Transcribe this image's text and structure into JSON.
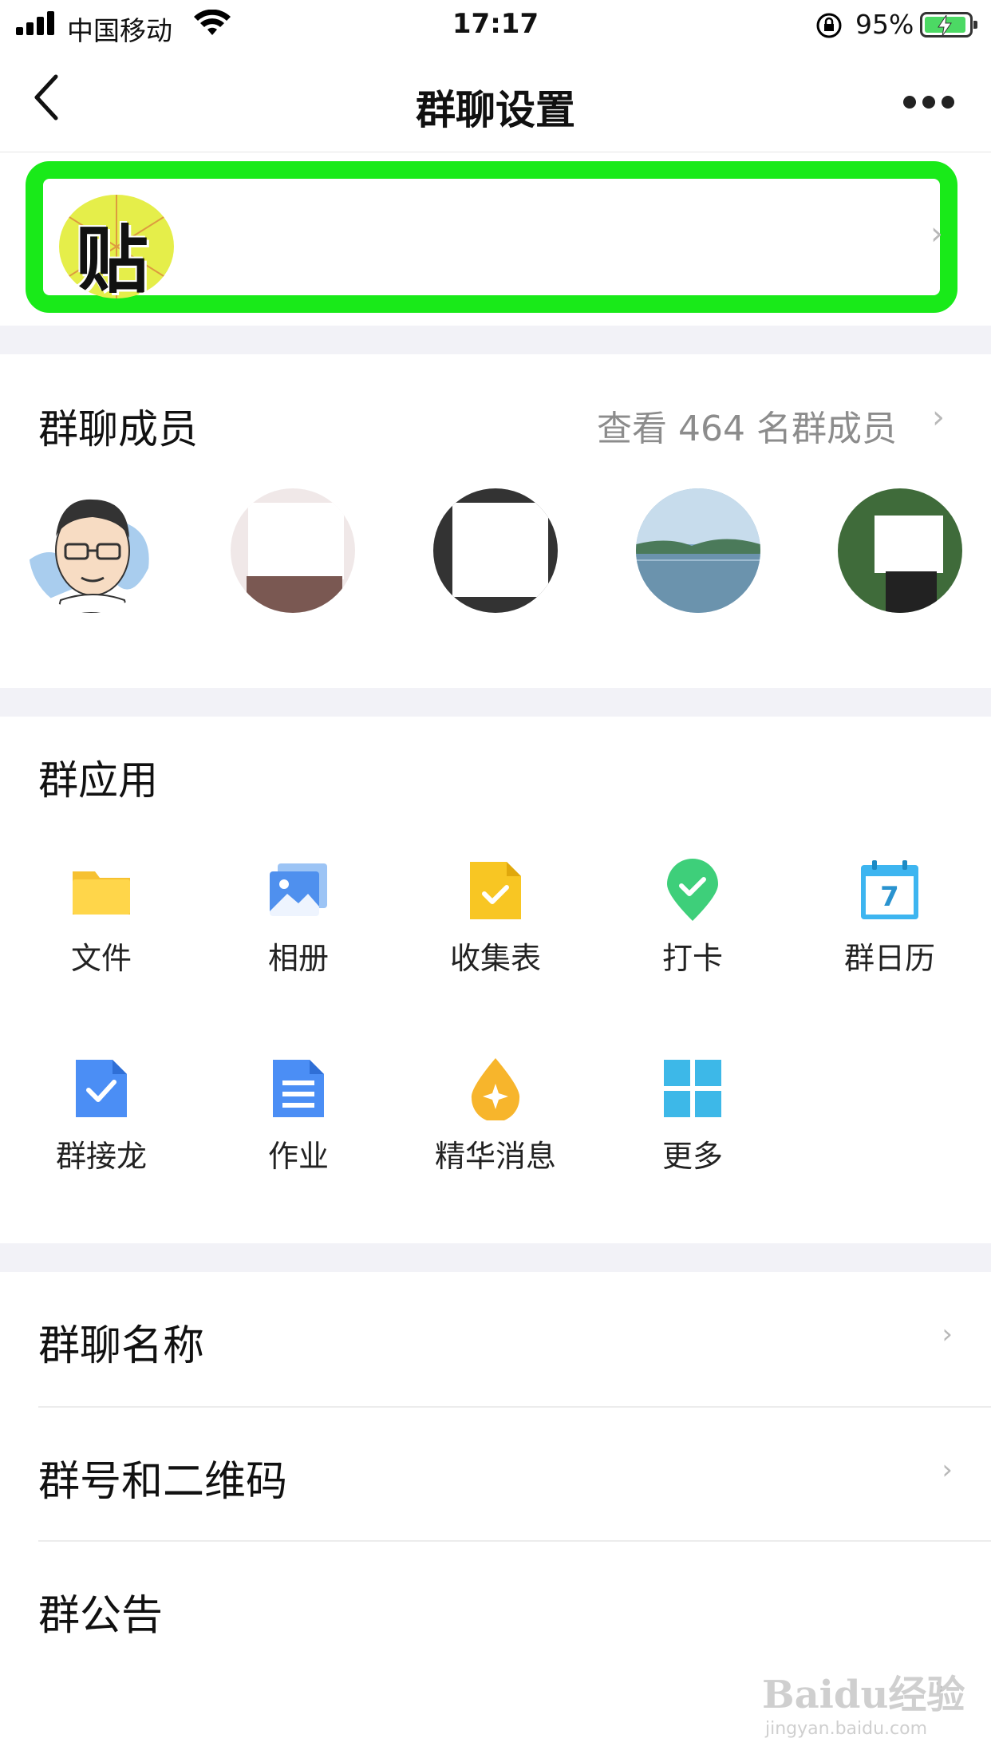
{
  "status_bar": {
    "carrier": "中国移动",
    "time": "17:17",
    "battery": "95%"
  },
  "nav": {
    "title": "群聊设置"
  },
  "members": {
    "title": "群聊成员",
    "view_all": "查看 464 名群成员"
  },
  "apps": {
    "title": "群应用",
    "items": [
      {
        "label": "文件",
        "icon": "folder-icon"
      },
      {
        "label": "相册",
        "icon": "album-icon"
      },
      {
        "label": "收集表",
        "icon": "form-icon"
      },
      {
        "label": "打卡",
        "icon": "checkin-icon"
      },
      {
        "label": "群日历",
        "icon": "calendar-icon"
      },
      {
        "label": "群接龙",
        "icon": "relay-icon"
      },
      {
        "label": "作业",
        "icon": "homework-icon"
      },
      {
        "label": "精华消息",
        "icon": "essence-icon"
      },
      {
        "label": "更多",
        "icon": "more-apps-icon"
      }
    ],
    "calendar_day": "7"
  },
  "rows": [
    {
      "label": "群聊名称"
    },
    {
      "label": "群号和二维码"
    },
    {
      "label": "群公告"
    }
  ],
  "group": {
    "avatar_char": "贴"
  },
  "watermark": {
    "brand": "Baidu经验",
    "url": "jingyan.baidu.com"
  }
}
